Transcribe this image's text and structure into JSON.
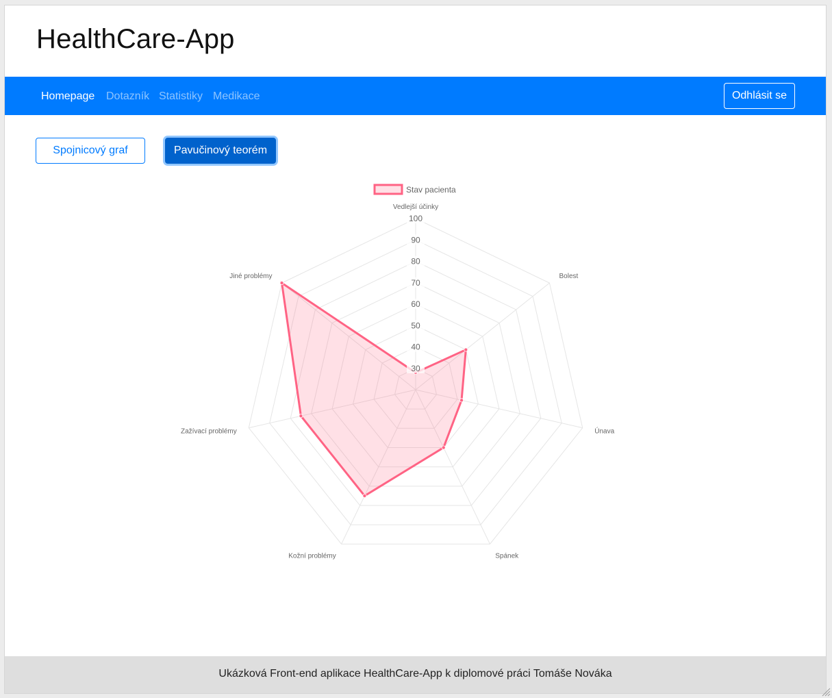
{
  "app": {
    "title": "HealthCare-App"
  },
  "nav": {
    "items": [
      {
        "label": "Homepage",
        "active": true
      },
      {
        "label": "Dotazník",
        "active": false
      },
      {
        "label": "Statistiky",
        "active": false
      },
      {
        "label": "Medikace",
        "active": false
      }
    ],
    "logout_label": "Odhlásit se"
  },
  "chart_switch": {
    "line_label": "Spojnicový graf",
    "radar_label": "Pavučinový teorém",
    "selected": "radar"
  },
  "chart_data": {
    "type": "radar",
    "labels": [
      "Vedlejší účinky",
      "Bolest",
      "Únava",
      "Spánek",
      "Kožní problémy",
      "Zažívací problémy",
      "Jiné problémy"
    ],
    "tick_labels": [
      "30",
      "40",
      "50",
      "60",
      "70",
      "80",
      "90",
      "100"
    ],
    "rlim": [
      20,
      100
    ],
    "series": [
      {
        "name": "Stav pacienta",
        "values": [
          28,
          50,
          42,
          50,
          75,
          75,
          100
        ]
      }
    ],
    "legend": "top",
    "colors": {
      "line": "#ff6384",
      "fill": "rgba(255,99,132,0.2)",
      "grid": "#e5e5e5"
    }
  },
  "footer": {
    "text": "Ukázková Front-end aplikace HealthCare-App k diplomové práci Tomáše Nováka"
  },
  "colors": {
    "primary": "#007bff",
    "primary_active": "#0062cc",
    "footer_bg": "#dedede"
  }
}
